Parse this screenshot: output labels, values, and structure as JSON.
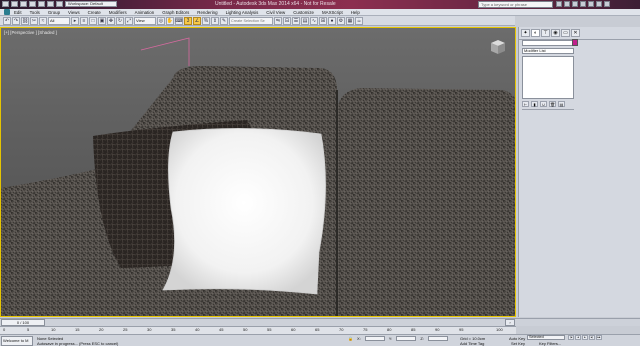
{
  "titlebar": {
    "workspace": "Workspace: Default",
    "title": "Untitled - Autodesk 3ds Max 2014 x64 - Not for Resale",
    "search_placeholder": "Type a keyword or phrase"
  },
  "menu": [
    "Edit",
    "Tools",
    "Group",
    "Views",
    "Create",
    "Modifiers",
    "Animation",
    "Graph Editors",
    "Rendering",
    "Lighting Analysis",
    "Civil View",
    "Customize",
    "MAXScript",
    "Help"
  ],
  "toolbar": {
    "filter_label": "All",
    "view_label": "View",
    "selection_set_placeholder": "Create Selection Se"
  },
  "viewport": {
    "label": "[+] [Perspective ] [Shaded ]"
  },
  "command_panel": {
    "modifier_list": "Modifier List"
  },
  "timeslider": {
    "frame": "0 / 100",
    "ticks": [
      "0",
      "5",
      "10",
      "15",
      "20",
      "25",
      "30",
      "35",
      "40",
      "45",
      "50",
      "55",
      "60",
      "65",
      "70",
      "75",
      "80",
      "85",
      "90",
      "95",
      "100"
    ]
  },
  "status": {
    "maxscript_label": "Welcome to M",
    "selection_status": "None Selected",
    "prompt": "Autosave in progress... (Press ESC to cancel)",
    "x_label": "X:",
    "y_label": "Y:",
    "z_label": "Z:",
    "grid": "Grid = 10.0cm",
    "add_time_tag": "Add Time Tag",
    "auto_key": "Auto Key",
    "set_key": "Set Key",
    "selected": "Selected",
    "key_filters": "Key Filters..."
  },
  "colors": {
    "viewport_border": "#e5c400",
    "object_color": "#c0208a"
  }
}
